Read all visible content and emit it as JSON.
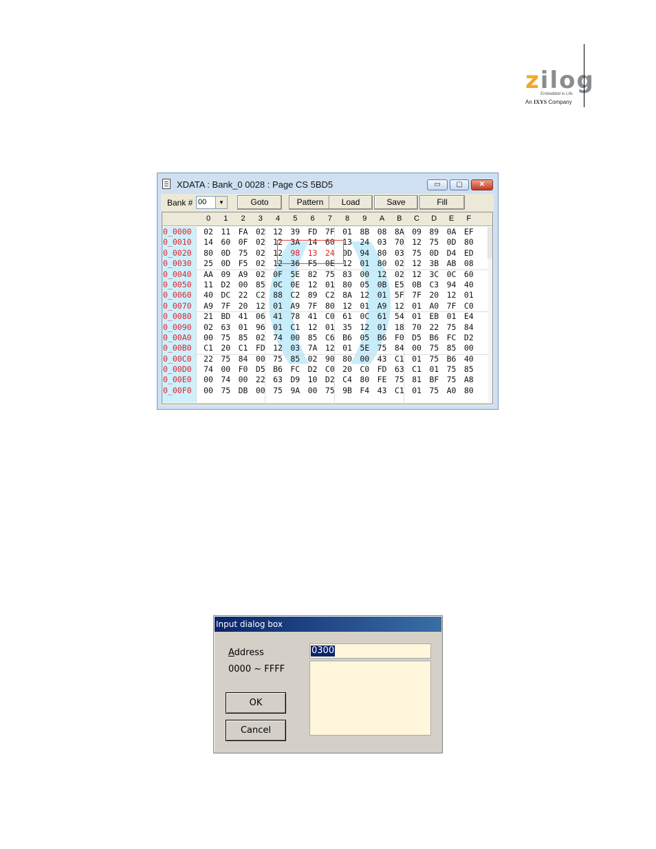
{
  "logo": {
    "brand_letter": "z",
    "brand_rest": "ilog",
    "tagline": "Embedded in Life",
    "sub_prefix": "An",
    "sub_brand": "IXYS",
    "sub_suffix": "Company"
  },
  "xdata_window": {
    "title": "XDATA : Bank_0 0028 : Page CS 5BD5",
    "buttons": {
      "minimize": "▭",
      "maximize": "▢",
      "close": "✕"
    },
    "toolbar": {
      "bank_label": "Bank #",
      "bank_value": "00",
      "goto": "Goto",
      "pattern": "Pattern",
      "load": "Load",
      "save": "Save",
      "fill": "Fill"
    },
    "columns": [
      "0",
      "1",
      "2",
      "3",
      "4",
      "5",
      "6",
      "7",
      "8",
      "9",
      "A",
      "B",
      "C",
      "D",
      "E",
      "F"
    ],
    "rows": [
      {
        "addr": "0_0000",
        "bytes": [
          "02",
          "11",
          "FA",
          "02",
          "12",
          "39",
          "FD",
          "7F",
          "01",
          "8B",
          "08",
          "8A",
          "09",
          "89",
          "0A",
          "EF"
        ]
      },
      {
        "addr": "0_0010",
        "bytes": [
          "14",
          "60",
          "0F",
          "02",
          "12",
          "3A",
          "14",
          "60",
          "13",
          "24",
          "03",
          "70",
          "12",
          "75",
          "0D",
          "80"
        ]
      },
      {
        "addr": "0_0020",
        "bytes": [
          "80",
          "0D",
          "75",
          "02",
          "12",
          "98",
          "13",
          "24",
          "0D",
          "94",
          "80",
          "03",
          "75",
          "0D",
          "D4",
          "ED"
        ]
      },
      {
        "addr": "0_0030",
        "bytes": [
          "25",
          "0D",
          "F5",
          "02",
          "12",
          "36",
          "F5",
          "0E",
          "12",
          "01",
          "80",
          "02",
          "12",
          "3B",
          "AB",
          "08"
        ]
      },
      {
        "addr": "0_0040",
        "bytes": [
          "AA",
          "09",
          "A9",
          "02",
          "0F",
          "5E",
          "82",
          "75",
          "83",
          "00",
          "12",
          "02",
          "12",
          "3C",
          "0C",
          "60"
        ]
      },
      {
        "addr": "0_0050",
        "bytes": [
          "11",
          "D2",
          "00",
          "85",
          "0C",
          "0E",
          "12",
          "01",
          "80",
          "05",
          "0B",
          "E5",
          "0B",
          "C3",
          "94",
          "40"
        ]
      },
      {
        "addr": "0_0060",
        "bytes": [
          "40",
          "DC",
          "22",
          "C2",
          "88",
          "C2",
          "89",
          "C2",
          "8A",
          "12",
          "01",
          "5F",
          "7F",
          "20",
          "12",
          "01"
        ]
      },
      {
        "addr": "0_0070",
        "bytes": [
          "A9",
          "7F",
          "20",
          "12",
          "01",
          "A9",
          "7F",
          "80",
          "12",
          "01",
          "A9",
          "12",
          "01",
          "A0",
          "7F",
          "C0"
        ]
      },
      {
        "addr": "0_0080",
        "bytes": [
          "21",
          "BD",
          "41",
          "06",
          "41",
          "78",
          "41",
          "C0",
          "61",
          "0C",
          "61",
          "54",
          "01",
          "EB",
          "01",
          "E4"
        ]
      },
      {
        "addr": "0_0090",
        "bytes": [
          "02",
          "63",
          "01",
          "96",
          "01",
          "C1",
          "12",
          "01",
          "35",
          "12",
          "01",
          "18",
          "70",
          "22",
          "75",
          "84"
        ]
      },
      {
        "addr": "0_00A0",
        "bytes": [
          "00",
          "75",
          "85",
          "02",
          "74",
          "00",
          "85",
          "C6",
          "B6",
          "05",
          "B6",
          "F0",
          "D5",
          "B6",
          "FC",
          "D2"
        ]
      },
      {
        "addr": "0_00B0",
        "bytes": [
          "C1",
          "20",
          "C1",
          "FD",
          "12",
          "03",
          "7A",
          "12",
          "01",
          "5E",
          "75",
          "84",
          "00",
          "75",
          "85",
          "00"
        ]
      },
      {
        "addr": "0_00C0",
        "bytes": [
          "22",
          "75",
          "84",
          "00",
          "75",
          "85",
          "02",
          "90",
          "80",
          "00",
          "43",
          "C1",
          "01",
          "75",
          "B6",
          "40"
        ]
      },
      {
        "addr": "0_00D0",
        "bytes": [
          "74",
          "00",
          "F0",
          "D5",
          "B6",
          "FC",
          "D2",
          "C0",
          "20",
          "C0",
          "FD",
          "63",
          "C1",
          "01",
          "75",
          "85"
        ]
      },
      {
        "addr": "0_00E0",
        "bytes": [
          "00",
          "74",
          "00",
          "22",
          "63",
          "D9",
          "10",
          "D2",
          "C4",
          "80",
          "FE",
          "75",
          "81",
          "BF",
          "75",
          "A8"
        ]
      },
      {
        "addr": "0_00F0",
        "bytes": [
          "00",
          "75",
          "DB",
          "00",
          "75",
          "9A",
          "00",
          "75",
          "9B",
          "F4",
          "43",
          "C1",
          "01",
          "75",
          "A0",
          "80"
        ]
      }
    ],
    "highlight": {
      "row": 2,
      "cols": [
        5,
        6,
        7
      ],
      "color": "#e0202a"
    }
  },
  "input_dialog": {
    "title": "Input dialog box",
    "address_label_key": "A",
    "address_label_rest": "ddress",
    "range_label": "0000 ~ FFFF",
    "address_value": "0300",
    "ok": "OK",
    "cancel": "Cancel"
  },
  "colors": {
    "address_red": "#e0202a",
    "address_column_bg": "#cdf0fb",
    "dialog_title_bg": "#0a246a",
    "dialog_field_bg": "#fff6dc"
  }
}
